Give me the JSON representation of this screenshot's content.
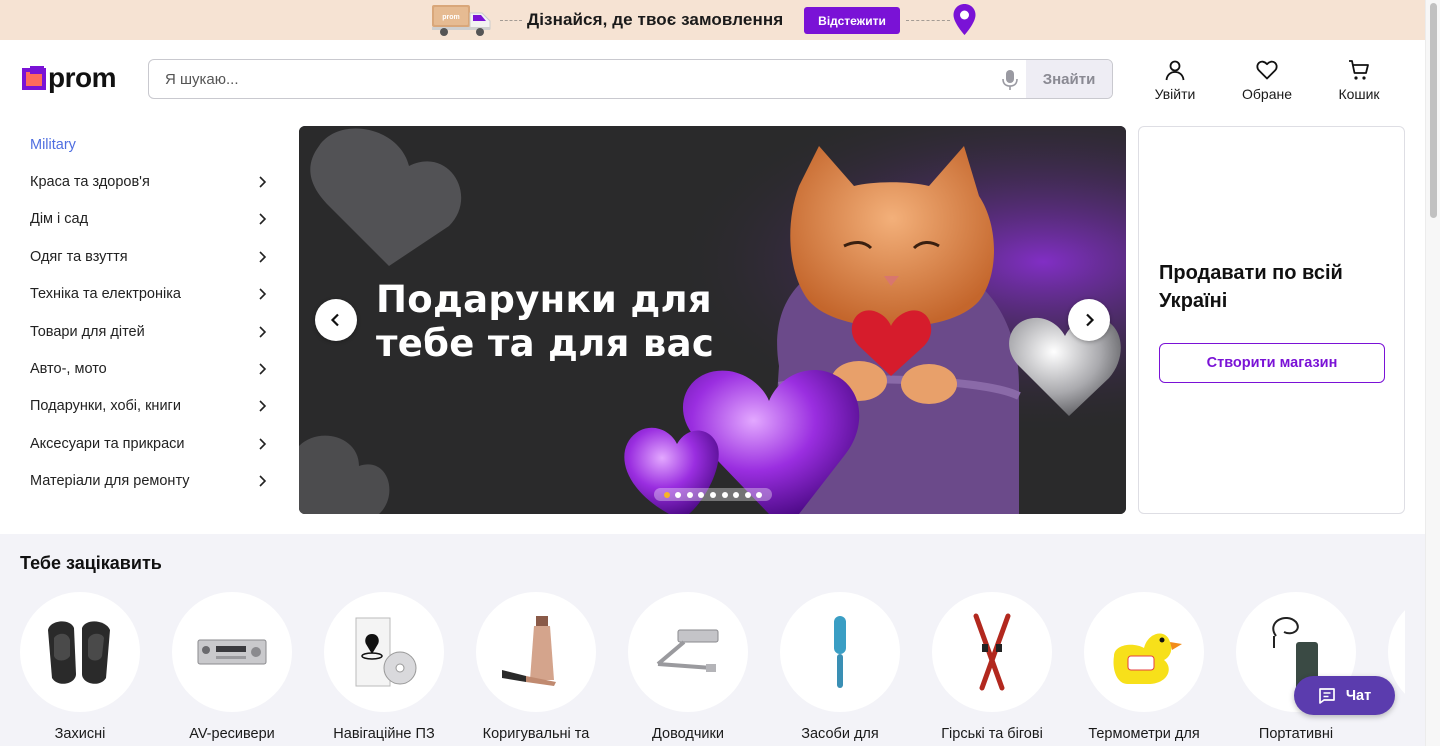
{
  "promo": {
    "text": "Дізнайся, де твоє замовлення",
    "button": "Відстежити",
    "truck_label": "prom"
  },
  "header": {
    "logo": "prom",
    "search_placeholder": "Я шукаю...",
    "search_button": "Знайти",
    "login": "Увійти",
    "favorites": "Обране",
    "cart": "Кошик"
  },
  "sidebar": {
    "categories": [
      {
        "label": "Military",
        "has_arrow": false
      },
      {
        "label": "Краса та здоров'я",
        "has_arrow": true
      },
      {
        "label": "Дім і сад",
        "has_arrow": true
      },
      {
        "label": "Одяг та взуття",
        "has_arrow": true
      },
      {
        "label": "Техніка та електроніка",
        "has_arrow": true
      },
      {
        "label": "Товари для дітей",
        "has_arrow": true
      },
      {
        "label": "Авто-, мото",
        "has_arrow": true
      },
      {
        "label": "Подарунки, хобі, книги",
        "has_arrow": true
      },
      {
        "label": "Аксесуари та прикраси",
        "has_arrow": true
      },
      {
        "label": "Матеріали для ремонту",
        "has_arrow": true
      }
    ]
  },
  "hero": {
    "line1": "Подарунки для",
    "line2": "тебе та для вас",
    "slide_count": 9,
    "active_slide": 1
  },
  "sell": {
    "title": "Продавати по всій Україні",
    "button": "Створити магазин"
  },
  "interest": {
    "title": "Тебе зацікавить",
    "items": [
      {
        "label": "Захисні",
        "icon": "knee-pads-icon"
      },
      {
        "label": "AV-ресивери",
        "icon": "av-receiver-icon"
      },
      {
        "label": "Навігаційне ПЗ",
        "icon": "navigation-software-icon"
      },
      {
        "label": "Коригувальні та",
        "icon": "concealer-bottle-icon"
      },
      {
        "label": "Доводчики",
        "icon": "door-closer-icon"
      },
      {
        "label": "Засоби для",
        "icon": "lint-roller-icon"
      },
      {
        "label": "Гірські та бігові",
        "icon": "ski-icon"
      },
      {
        "label": "Термометри для",
        "icon": "duck-thermometer-icon"
      },
      {
        "label": "Портативні",
        "icon": "power-bank-icon"
      }
    ]
  },
  "chat": {
    "label": "Чат"
  },
  "colors": {
    "accent": "#7a12d6",
    "promo_bg": "#f6e3d3",
    "section_bg": "#f3f3f8",
    "chat_bg": "#5b3cae",
    "military_link": "#4f6ee0"
  }
}
